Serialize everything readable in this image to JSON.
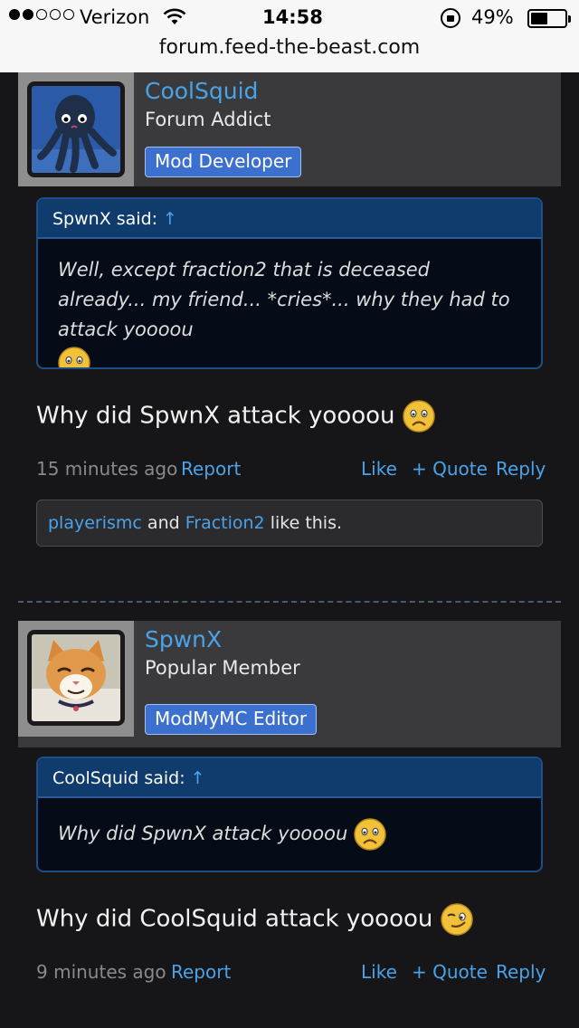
{
  "status": {
    "carrier": "Verizon",
    "time": "14:58",
    "battery": "49%",
    "battery_level": 0.49,
    "signal_bars": 2,
    "signal_total": 5
  },
  "url": "forum.feed-the-beast.com",
  "posts": [
    {
      "username": "CoolSquid",
      "user_title": "Forum Addict",
      "badge": "Mod Developer",
      "badge_color": "#3c70cf",
      "quote_author": "SpwnX said:",
      "quote_arrow": "↑",
      "quote_text": "Well, except fraction2 that is deceased already... my friend... *cries*... why they had to attack yoooou",
      "message": "Why did SpwnX attack yoooou",
      "message_emoji": "sad-face-icon",
      "time": "15 minutes ago",
      "report": "Report",
      "like": "Like",
      "quote": "+ Quote",
      "reply": "Reply",
      "liker1": "playerismc",
      "and": "and",
      "liker2": "Fraction2",
      "like_suffix": "like this."
    },
    {
      "username": "SpwnX",
      "user_title": "Popular Member",
      "badge": "ModMyMC Editor",
      "badge_color": "#3c70cf",
      "quote_author": "CoolSquid said:",
      "quote_arrow": "↑",
      "quote_text": "Why did SpwnX attack yoooou",
      "message": "Why did CoolSquid attack yoooou",
      "message_emoji": "winking-face-icon",
      "time": "9 minutes ago",
      "report": "Report",
      "like": "Like",
      "quote": "+ Quote",
      "reply": "Reply"
    }
  ],
  "colors": {
    "link": "#4aa3e8",
    "background": "#161618",
    "quote_header": "#0f3c6c"
  }
}
